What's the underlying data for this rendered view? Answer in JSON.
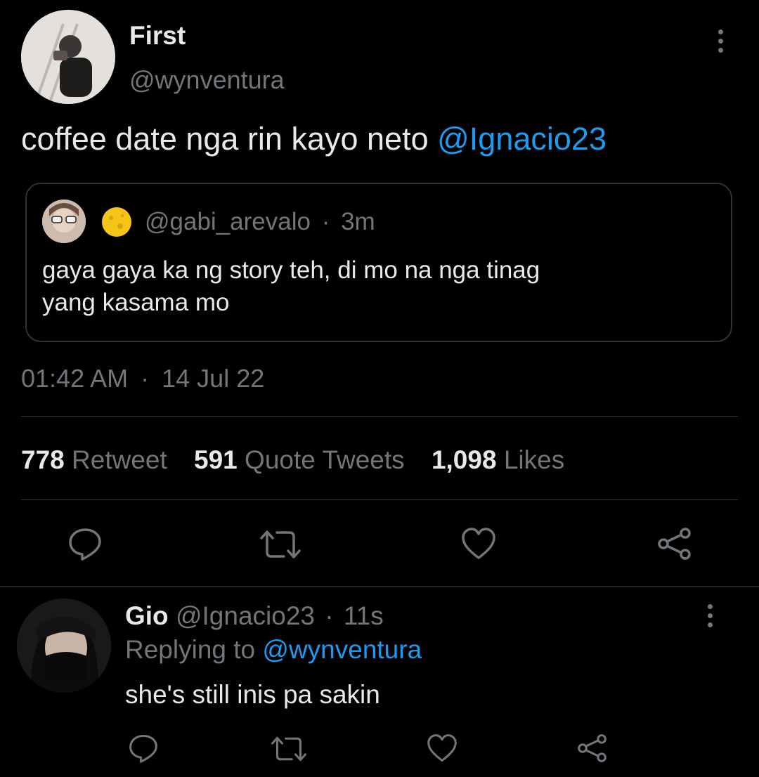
{
  "main_tweet": {
    "display_name": "First",
    "handle": "@wynventura",
    "text": "coffee date nga rin kayo neto",
    "mention": "@Ignacio23",
    "quoted": {
      "handle": "@gabi_arevalo",
      "separator": "·",
      "time": "3m",
      "text_line1": "gaya gaya ka ng story teh, di mo na nga tinag",
      "text_line2": "yang kasama mo"
    },
    "time": "01:42 AM",
    "separator": "·",
    "date": "14 Jul 22"
  },
  "stats": {
    "retweets_count": "778",
    "retweets_label": "Retweet",
    "quotes_count": "591",
    "quotes_label": "Quote Tweets",
    "likes_count": "1,098",
    "likes_label": "Likes"
  },
  "reply": {
    "display_name": "Gio",
    "handle": "@Ignacio23",
    "separator": "·",
    "time": "11s",
    "replying_prefix": "Replying to",
    "replying_handle": "@wynventura",
    "text": "she's still inis pa sakin"
  },
  "icons": {
    "reply": "reply-icon",
    "retweet": "retweet-icon",
    "like": "heart-icon",
    "share": "share-icon",
    "more": "more-icon"
  },
  "colors": {
    "background": "#000000",
    "text": "#e7e9ea",
    "secondary": "#71767b",
    "accent": "#1d9bf0",
    "divider": "#2f3336"
  }
}
